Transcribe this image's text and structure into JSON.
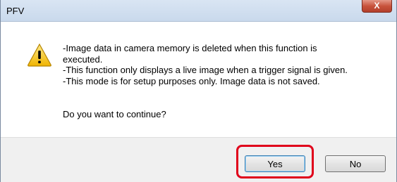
{
  "window": {
    "title": "PFV",
    "close_label": "X"
  },
  "message": {
    "lines": [
      "-Image data in camera memory is deleted when this function is",
      "executed.",
      "-This function only displays a live image when a trigger signal is given.",
      "-This mode is for setup purposes only. Image data is not saved."
    ],
    "question": "Do you want to continue?"
  },
  "buttons": {
    "yes_label": "Yes",
    "no_label": "No"
  },
  "icons": {
    "warning": "warning-icon"
  },
  "colors": {
    "highlight": "#e0001b",
    "warning_yellow": "#f5c81a"
  }
}
